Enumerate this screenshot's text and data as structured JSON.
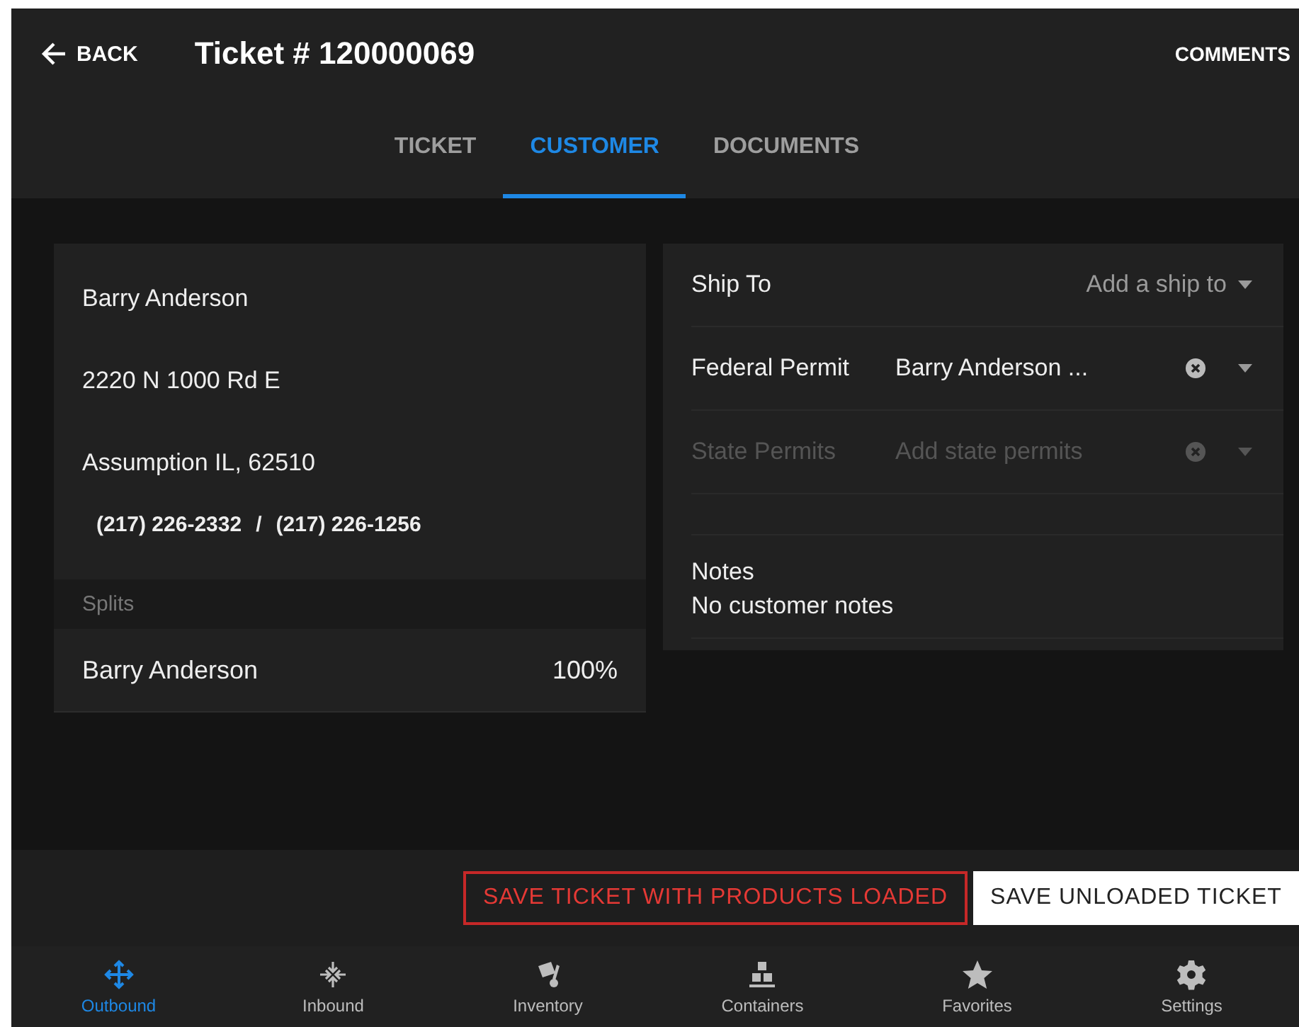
{
  "header": {
    "back": "BACK",
    "title": "Ticket # 120000069",
    "comments": "COMMENTS"
  },
  "tabs": [
    {
      "label": "TICKET",
      "selected": false
    },
    {
      "label": "CUSTOMER",
      "selected": true
    },
    {
      "label": "DOCUMENTS",
      "selected": false
    }
  ],
  "customer": {
    "name": "Barry Anderson",
    "address": "2220 N 1000 Rd E",
    "city": "Assumption IL, 62510",
    "phones": [
      "(217) 226-2332",
      "(217) 226-1256"
    ],
    "phone_separator": "/"
  },
  "splits": {
    "heading": "Splits",
    "rows": [
      {
        "name": "Barry Anderson",
        "share": "100%"
      }
    ]
  },
  "ship_to": {
    "label": "Ship To",
    "placeholder": "Add a ship to"
  },
  "permits": [
    {
      "label": "Federal Permit",
      "value": "Barry Anderson ...",
      "disabled": false
    },
    {
      "label": "State Permits",
      "placeholder": "Add state permits",
      "disabled": true
    }
  ],
  "notes": {
    "label": "Notes",
    "text": "No customer notes"
  },
  "actions": [
    {
      "label": "SAVE TICKET WITH PRODUCTS LOADED",
      "kind": "outlined"
    },
    {
      "label": "SAVE UNLOADED TICKET",
      "kind": "filled"
    }
  ],
  "nav": [
    {
      "label": "Outbound",
      "kind": "move",
      "selected": true
    },
    {
      "label": "Inbound",
      "kind": "inward",
      "selected": false
    },
    {
      "label": "Inventory",
      "kind": "dolly",
      "selected": false
    },
    {
      "label": "Containers",
      "kind": "bins",
      "selected": false
    },
    {
      "label": "Favorites",
      "kind": "star",
      "selected": false
    },
    {
      "label": "Settings",
      "kind": "gear",
      "selected": false
    }
  ]
}
